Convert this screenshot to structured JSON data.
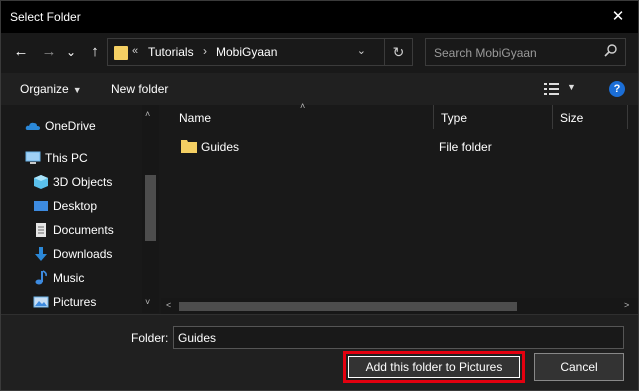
{
  "window": {
    "title": "Select Folder",
    "close_glyph": "✕"
  },
  "navigation": {
    "back_glyph": "←",
    "forward_glyph": "→",
    "recent_glyph": "⌄",
    "up_glyph": "↑",
    "address": {
      "overflow_glyph": "«",
      "crumbs": [
        "Tutorials",
        "MobiGyaan"
      ],
      "separator": "›",
      "dropdown_glyph": "⌄",
      "refresh_glyph": "↻"
    },
    "search": {
      "placeholder": "Search MobiGyaan",
      "icon": "search-icon"
    }
  },
  "toolbar": {
    "organize_label": "Organize",
    "organize_caret": "▼",
    "new_folder_label": "New folder",
    "view_caret": "▼",
    "help_label": "?"
  },
  "nav_pane": {
    "items": [
      {
        "label": "OneDrive",
        "icon": "cloud-icon"
      },
      {
        "label": "This PC",
        "icon": "computer-icon"
      },
      {
        "label": "3D Objects",
        "icon": "cube-icon"
      },
      {
        "label": "Desktop",
        "icon": "desktop-icon"
      },
      {
        "label": "Documents",
        "icon": "document-icon"
      },
      {
        "label": "Downloads",
        "icon": "download-icon"
      },
      {
        "label": "Music",
        "icon": "music-icon"
      },
      {
        "label": "Pictures",
        "icon": "pictures-icon"
      }
    ],
    "scroll_up_glyph": "˄",
    "scroll_down_glyph": "˅"
  },
  "file_list": {
    "columns": [
      "Name",
      "Type",
      "Size"
    ],
    "sort_glyph": "˄",
    "rows": [
      {
        "name": "Guides",
        "type": "File folder"
      }
    ],
    "scroll_left_glyph": "<",
    "scroll_right_glyph": ">"
  },
  "bottom": {
    "folder_label": "Folder:",
    "folder_value": "Guides",
    "primary_button": "Add this folder to Pictures",
    "cancel_button": "Cancel"
  },
  "colors": {
    "background": "#191919",
    "accent_highlight": "#e3000f",
    "folder_yellow": "#f4cf63",
    "help_blue": "#1b6ed6"
  }
}
